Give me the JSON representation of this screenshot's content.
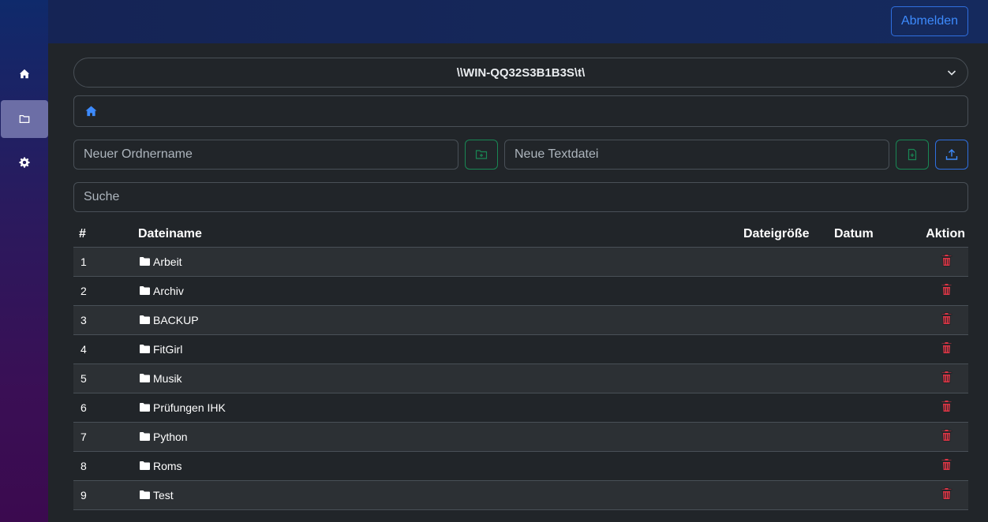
{
  "header": {
    "logout_label": "Abmelden"
  },
  "sidebar": {
    "items": [
      {
        "icon": "home-icon",
        "active": false
      },
      {
        "icon": "folder-icon",
        "active": true
      },
      {
        "icon": "gear-icon",
        "active": false
      }
    ]
  },
  "path": {
    "selected": "\\\\WIN-QQ32S3B1B3S\\t\\"
  },
  "forms": {
    "folder_placeholder": "Neuer Ordnername",
    "textfile_placeholder": "Neue Textdatei",
    "search_placeholder": "Suche"
  },
  "table": {
    "headers": {
      "num": "#",
      "name": "Dateiname",
      "size": "Dateigröße",
      "date": "Datum",
      "action": "Aktion"
    },
    "rows": [
      {
        "num": "1",
        "name": "Arbeit"
      },
      {
        "num": "2",
        "name": "Archiv"
      },
      {
        "num": "3",
        "name": "BACKUP"
      },
      {
        "num": "4",
        "name": "FitGirl"
      },
      {
        "num": "5",
        "name": "Musik"
      },
      {
        "num": "6",
        "name": "Prüfungen IHK"
      },
      {
        "num": "7",
        "name": "Python"
      },
      {
        "num": "8",
        "name": "Roms"
      },
      {
        "num": "9",
        "name": "Test"
      }
    ]
  },
  "colors": {
    "accent": "#3d8bfd",
    "success": "#198754",
    "danger": "#dc3545",
    "background": "#212529"
  }
}
